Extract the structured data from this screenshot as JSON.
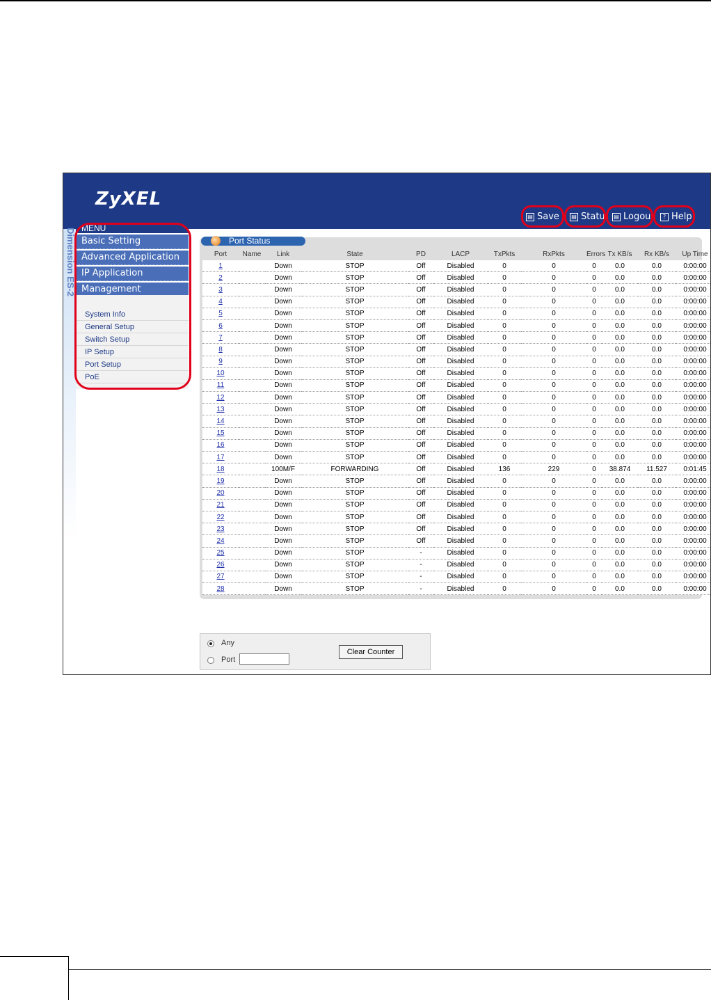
{
  "app": {
    "logo": "ZyXEL",
    "side_label": "Dimension ES-2",
    "top_buttons": [
      {
        "label": "Save",
        "icon": "save-icon"
      },
      {
        "label": "Statu",
        "icon": "status-icon"
      },
      {
        "label": "Logou",
        "icon": "logout-icon"
      },
      {
        "label": "Help",
        "icon": "help-icon"
      }
    ]
  },
  "menu": {
    "title": "MENU",
    "items": [
      "Basic Setting",
      "Advanced Application",
      "IP Application",
      "Management"
    ],
    "subitems": [
      "System Info",
      "General Setup",
      "Switch Setup",
      "IP Setup",
      "Port Setup",
      "PoE"
    ]
  },
  "port_status": {
    "title": "Port Status",
    "columns": [
      "Port",
      "Name",
      "Link",
      "State",
      "PD",
      "LACP",
      "TxPkts",
      "RxPkts",
      "Errors",
      "Tx KB/s",
      "Rx KB/s",
      "Up Time"
    ],
    "rows": [
      [
        "1",
        "",
        "Down",
        "STOP",
        "Off",
        "Disabled",
        "0",
        "0",
        "0",
        "0.0",
        "0.0",
        "0:00:00"
      ],
      [
        "2",
        "",
        "Down",
        "STOP",
        "Off",
        "Disabled",
        "0",
        "0",
        "0",
        "0.0",
        "0.0",
        "0:00:00"
      ],
      [
        "3",
        "",
        "Down",
        "STOP",
        "Off",
        "Disabled",
        "0",
        "0",
        "0",
        "0.0",
        "0.0",
        "0:00:00"
      ],
      [
        "4",
        "",
        "Down",
        "STOP",
        "Off",
        "Disabled",
        "0",
        "0",
        "0",
        "0.0",
        "0.0",
        "0:00:00"
      ],
      [
        "5",
        "",
        "Down",
        "STOP",
        "Off",
        "Disabled",
        "0",
        "0",
        "0",
        "0.0",
        "0.0",
        "0:00:00"
      ],
      [
        "6",
        "",
        "Down",
        "STOP",
        "Off",
        "Disabled",
        "0",
        "0",
        "0",
        "0.0",
        "0.0",
        "0:00:00"
      ],
      [
        "7",
        "",
        "Down",
        "STOP",
        "Off",
        "Disabled",
        "0",
        "0",
        "0",
        "0.0",
        "0.0",
        "0:00:00"
      ],
      [
        "8",
        "",
        "Down",
        "STOP",
        "Off",
        "Disabled",
        "0",
        "0",
        "0",
        "0.0",
        "0.0",
        "0:00:00"
      ],
      [
        "9",
        "",
        "Down",
        "STOP",
        "Off",
        "Disabled",
        "0",
        "0",
        "0",
        "0.0",
        "0.0",
        "0:00:00"
      ],
      [
        "10",
        "",
        "Down",
        "STOP",
        "Off",
        "Disabled",
        "0",
        "0",
        "0",
        "0.0",
        "0.0",
        "0:00:00"
      ],
      [
        "11",
        "",
        "Down",
        "STOP",
        "Off",
        "Disabled",
        "0",
        "0",
        "0",
        "0.0",
        "0.0",
        "0:00:00"
      ],
      [
        "12",
        "",
        "Down",
        "STOP",
        "Off",
        "Disabled",
        "0",
        "0",
        "0",
        "0.0",
        "0.0",
        "0:00:00"
      ],
      [
        "13",
        "",
        "Down",
        "STOP",
        "Off",
        "Disabled",
        "0",
        "0",
        "0",
        "0.0",
        "0.0",
        "0:00:00"
      ],
      [
        "14",
        "",
        "Down",
        "STOP",
        "Off",
        "Disabled",
        "0",
        "0",
        "0",
        "0.0",
        "0.0",
        "0:00:00"
      ],
      [
        "15",
        "",
        "Down",
        "STOP",
        "Off",
        "Disabled",
        "0",
        "0",
        "0",
        "0.0",
        "0.0",
        "0:00:00"
      ],
      [
        "16",
        "",
        "Down",
        "STOP",
        "Off",
        "Disabled",
        "0",
        "0",
        "0",
        "0.0",
        "0.0",
        "0:00:00"
      ],
      [
        "17",
        "",
        "Down",
        "STOP",
        "Off",
        "Disabled",
        "0",
        "0",
        "0",
        "0.0",
        "0.0",
        "0:00:00"
      ],
      [
        "18",
        "",
        "100M/F",
        "FORWARDING",
        "Off",
        "Disabled",
        "136",
        "229",
        "0",
        "38.874",
        "11.527",
        "0:01:45"
      ],
      [
        "19",
        "",
        "Down",
        "STOP",
        "Off",
        "Disabled",
        "0",
        "0",
        "0",
        "0.0",
        "0.0",
        "0:00:00"
      ],
      [
        "20",
        "",
        "Down",
        "STOP",
        "Off",
        "Disabled",
        "0",
        "0",
        "0",
        "0.0",
        "0.0",
        "0:00:00"
      ],
      [
        "21",
        "",
        "Down",
        "STOP",
        "Off",
        "Disabled",
        "0",
        "0",
        "0",
        "0.0",
        "0.0",
        "0:00:00"
      ],
      [
        "22",
        "",
        "Down",
        "STOP",
        "Off",
        "Disabled",
        "0",
        "0",
        "0",
        "0.0",
        "0.0",
        "0:00:00"
      ],
      [
        "23",
        "",
        "Down",
        "STOP",
        "Off",
        "Disabled",
        "0",
        "0",
        "0",
        "0.0",
        "0.0",
        "0:00:00"
      ],
      [
        "24",
        "",
        "Down",
        "STOP",
        "Off",
        "Disabled",
        "0",
        "0",
        "0",
        "0.0",
        "0.0",
        "0:00:00"
      ],
      [
        "25",
        "",
        "Down",
        "STOP",
        "-",
        "Disabled",
        "0",
        "0",
        "0",
        "0.0",
        "0.0",
        "0:00:00"
      ],
      [
        "26",
        "",
        "Down",
        "STOP",
        "-",
        "Disabled",
        "0",
        "0",
        "0",
        "0.0",
        "0.0",
        "0:00:00"
      ],
      [
        "27",
        "",
        "Down",
        "STOP",
        "-",
        "Disabled",
        "0",
        "0",
        "0",
        "0.0",
        "0.0",
        "0:00:00"
      ],
      [
        "28",
        "",
        "Down",
        "STOP",
        "-",
        "Disabled",
        "0",
        "0",
        "0",
        "0.0",
        "0.0",
        "0:00:00"
      ]
    ]
  },
  "counter": {
    "any_label": "Any",
    "port_label": "Port",
    "port_value": "",
    "selected": "Any",
    "clear_label": "Clear Counter"
  },
  "colors": {
    "header": "#1e3a86",
    "menu_item": "#4a6fb8",
    "annotation_ring": "#e0001b"
  }
}
